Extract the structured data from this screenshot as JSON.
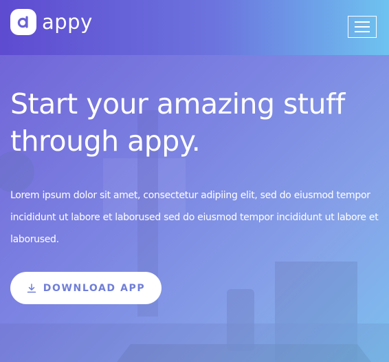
{
  "brand": {
    "name": "appy",
    "logo_icon": "app-logo-icon"
  },
  "nav": {
    "menu_icon": "hamburger-menu-icon"
  },
  "hero": {
    "headline": "Start your amazing stuff through appy.",
    "lead": "Lorem ipsum dolor sit amet, consectetur adipiing elit, sed do eiusmod tempor incididunt ut labore et laborused sed do eiusmod tempor incididunt ut labore et laborused.",
    "cta_label": "DOWNLOAD APP",
    "cta_icon": "download-icon"
  },
  "colors": {
    "gradient_start": "#5e4bd0",
    "gradient_mid": "#7c84e2",
    "gradient_end": "#6ec3f0",
    "cta_text": "#6f7ed8",
    "text": "#ffffff"
  }
}
